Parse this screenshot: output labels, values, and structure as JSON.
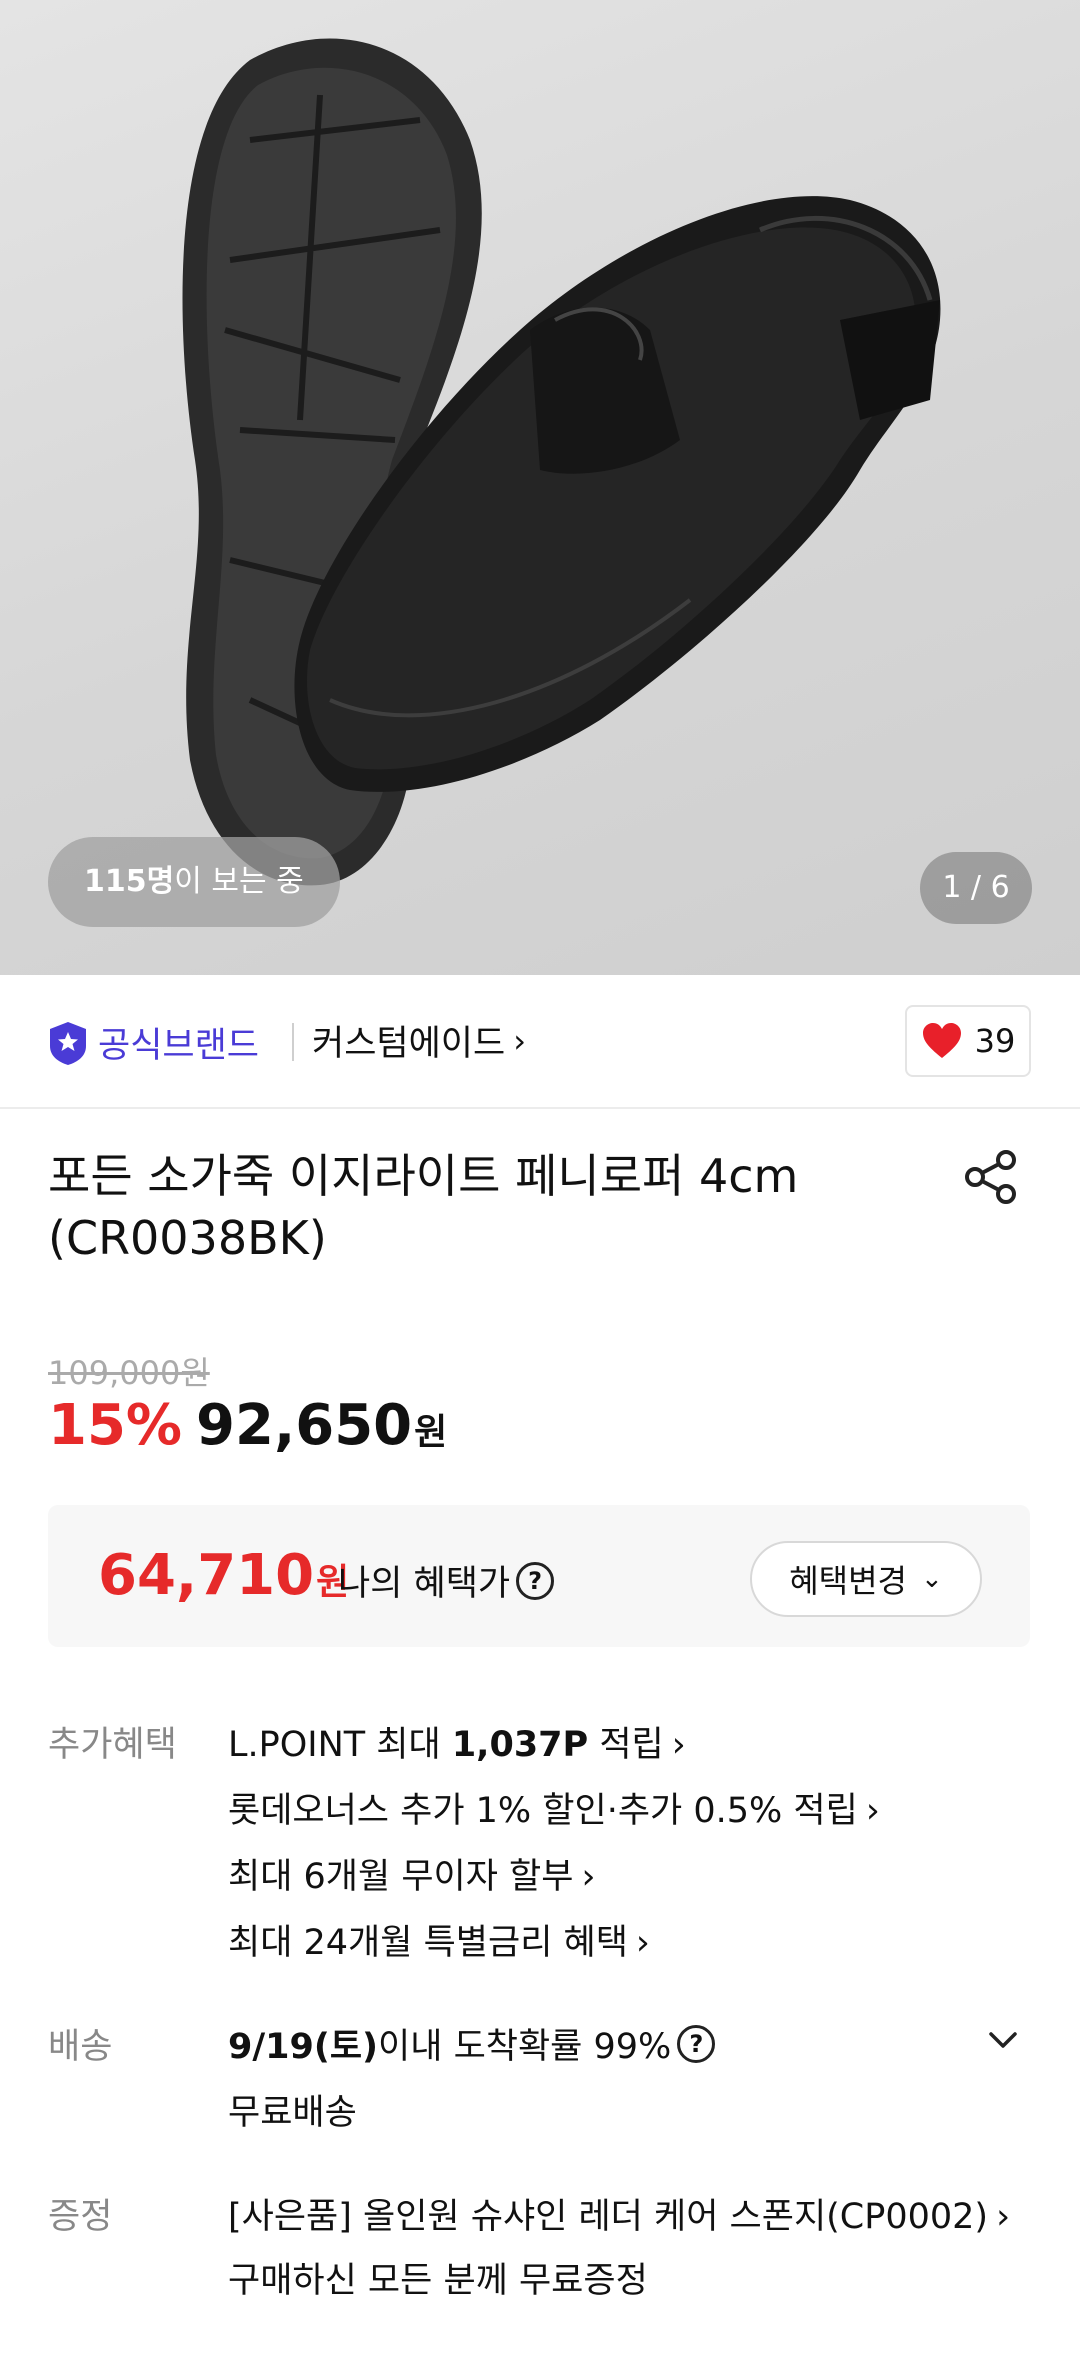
{
  "hero": {
    "viewers_count": "115명",
    "viewers_suffix": "이 보는 중",
    "pager": "1 / 6"
  },
  "brand": {
    "official_label": "공식브랜드",
    "brand_name": "커스텀에이드",
    "chevron": "›",
    "like_count": "39"
  },
  "product": {
    "title": "포든 소가죽 이지라이트 페니로퍼 4cm (CR0038BK)"
  },
  "price": {
    "original": "109,000원",
    "discount": "15%",
    "sale": "92,650",
    "won": "원"
  },
  "benefit": {
    "amount": "64,710",
    "unit": "원",
    "label": "나의 혜택가",
    "help": "?",
    "change_label": "혜택변경",
    "change_chevron": "⌄"
  },
  "extra": {
    "label": "추가혜택",
    "line1_pre": "L.POINT 최대 ",
    "line1_bold": "1,037P",
    "line1_post": " 적립",
    "line2": "롯데오너스 추가 1% 할인·추가 0.5% 적립",
    "line3": "최대 6개월 무이자 할부",
    "line4": "최대 24개월 특별금리 혜택",
    "arrow": "›"
  },
  "shipping": {
    "label": "배송",
    "date_bold": "9/19(토)",
    "date_post": " 이내 도착확률 99%",
    "help": "?",
    "free": "무료배송"
  },
  "gift": {
    "label": "증정",
    "line1": "[사은품] 올인원 슈샤인 레더 케어 스폰지(CP0002)",
    "line2": "구매하신 모든 분께 무료증정",
    "arrow": "›"
  },
  "colors": {
    "accent_red": "#e62a2a",
    "official_purple": "#4a3bd6",
    "heart": "#e8202a"
  }
}
